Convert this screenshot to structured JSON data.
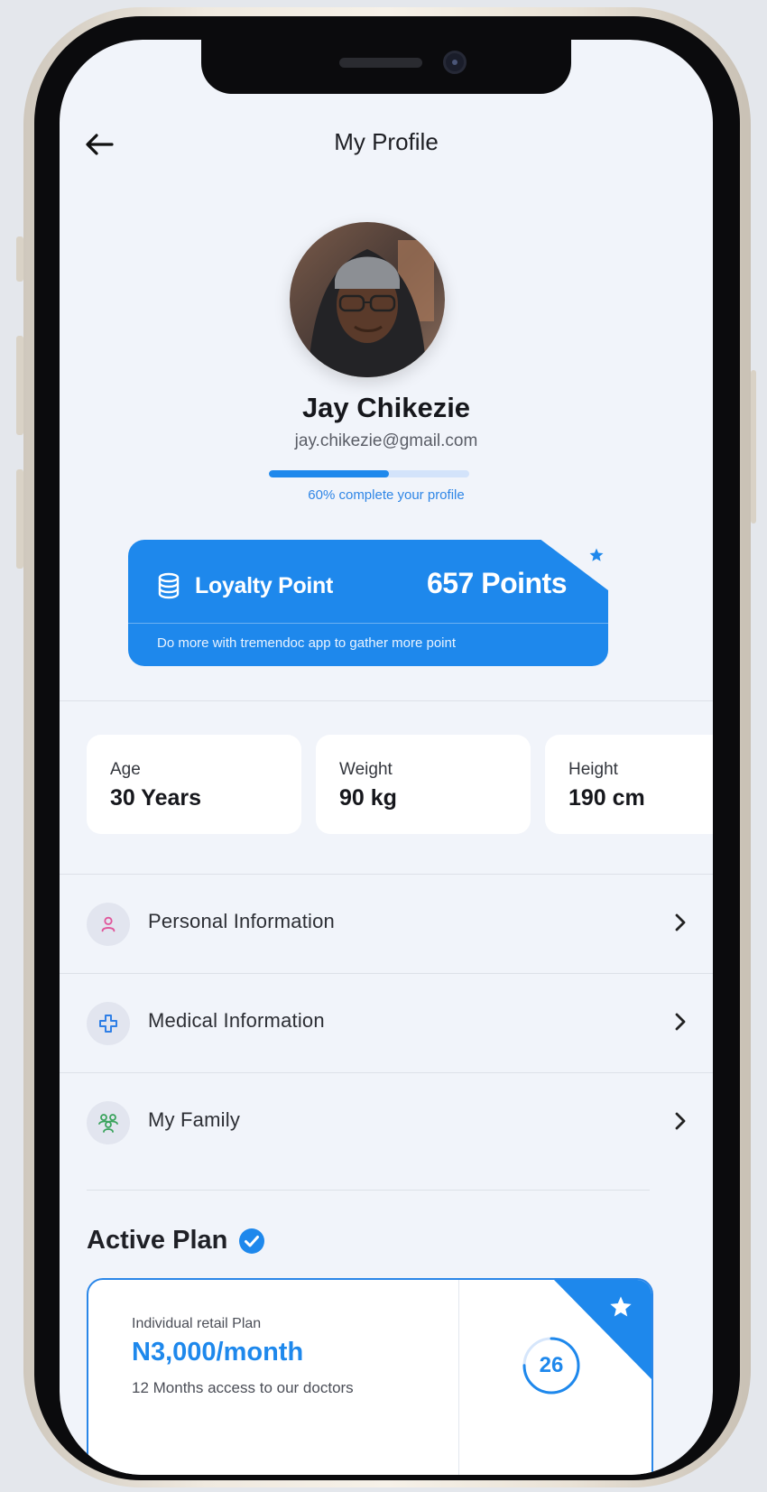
{
  "header": {
    "title": "My Profile"
  },
  "user": {
    "name": "Jay Chikezie",
    "email": "jay.chikezie@gmail.com",
    "profile_completion": 0.6,
    "profile_completion_label": "60% complete your profile"
  },
  "loyalty": {
    "title": "Loyalty Point",
    "points": "657 Points",
    "description": "Do more with tremendoc app to gather more point"
  },
  "stats": [
    {
      "label": "Age",
      "value": "30 Years"
    },
    {
      "label": "Weight",
      "value": "90 kg"
    },
    {
      "label": "Height",
      "value": "190 cm"
    }
  ],
  "menu": [
    {
      "label": "Personal Information",
      "icon": "person-icon"
    },
    {
      "label": "Medical Information",
      "icon": "medical-cross-icon"
    },
    {
      "label": "My Family",
      "icon": "family-icon"
    }
  ],
  "active_plan": {
    "title": "Active Plan",
    "plan_type": "Individual retail Plan",
    "price": "N3,000/month",
    "description": "12 Months access to our doctors",
    "days": "26",
    "days_progress": 0.75
  },
  "colors": {
    "accent": "#1e88ec",
    "background": "#f1f4fa",
    "card": "#ffffff"
  }
}
